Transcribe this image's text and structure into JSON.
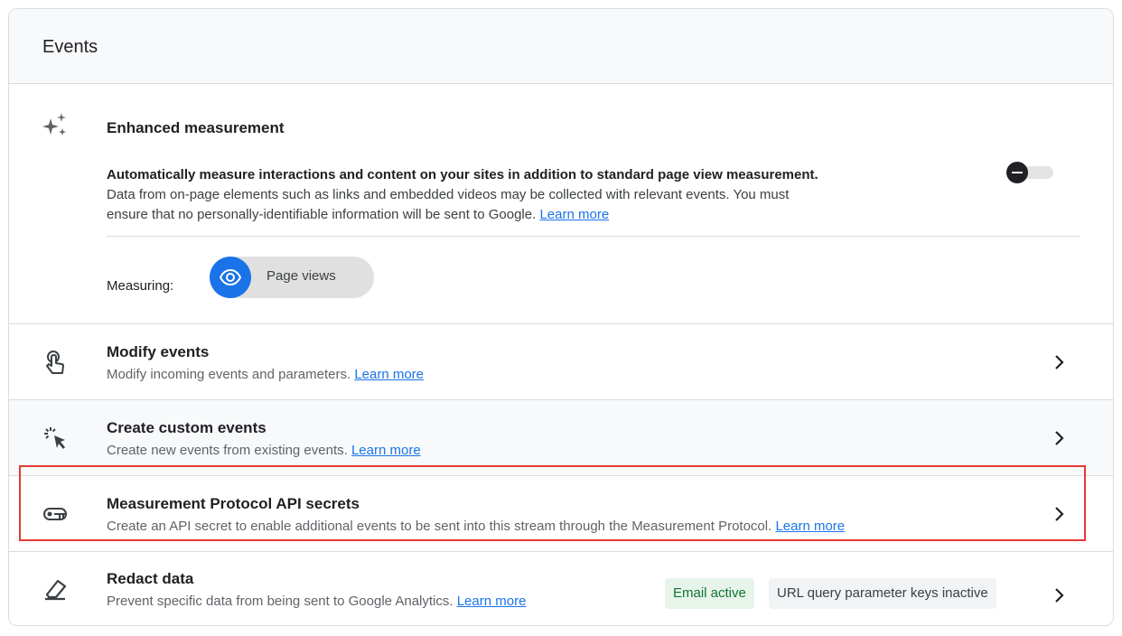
{
  "header": {
    "title": "Events"
  },
  "enhanced": {
    "title": "Enhanced measurement",
    "desc_bold": "Automatically measure interactions and content on your sites in addition to standard page view measurement.",
    "desc_line2": "Data from on-page elements such as links and embedded videos may be collected with relevant events. You must",
    "desc_line3": "ensure that no personally-identifiable information will be sent to Google.",
    "learn_more": "Learn more",
    "measuring_label": "Measuring:",
    "chip_label": "Page views",
    "toggle_state": "off"
  },
  "rows": [
    {
      "title": "Modify events",
      "subtitle": "Modify incoming events and parameters.",
      "link": "Learn more",
      "icon": "touch-icon"
    },
    {
      "title": "Create custom events",
      "subtitle": "Create new events from existing events.",
      "link": "Learn more",
      "icon": "click-sparkle-icon"
    },
    {
      "title": "Measurement Protocol API secrets",
      "subtitle": "Create an API secret to enable additional events to be sent into this stream through the Measurement Protocol.",
      "link": "Learn more",
      "icon": "key-icon"
    },
    {
      "title": "Redact data",
      "subtitle": "Prevent specific data from being sent to Google Analytics.",
      "link": "Learn more",
      "icon": "eraser-icon",
      "badges": {
        "email": "Email active",
        "url": "URL query parameter keys inactive"
      }
    }
  ],
  "colors": {
    "accent": "#1a73e8",
    "highlight": "#e53935",
    "badge_green_bg": "#e6f4ea",
    "badge_green_text": "#137333"
  }
}
